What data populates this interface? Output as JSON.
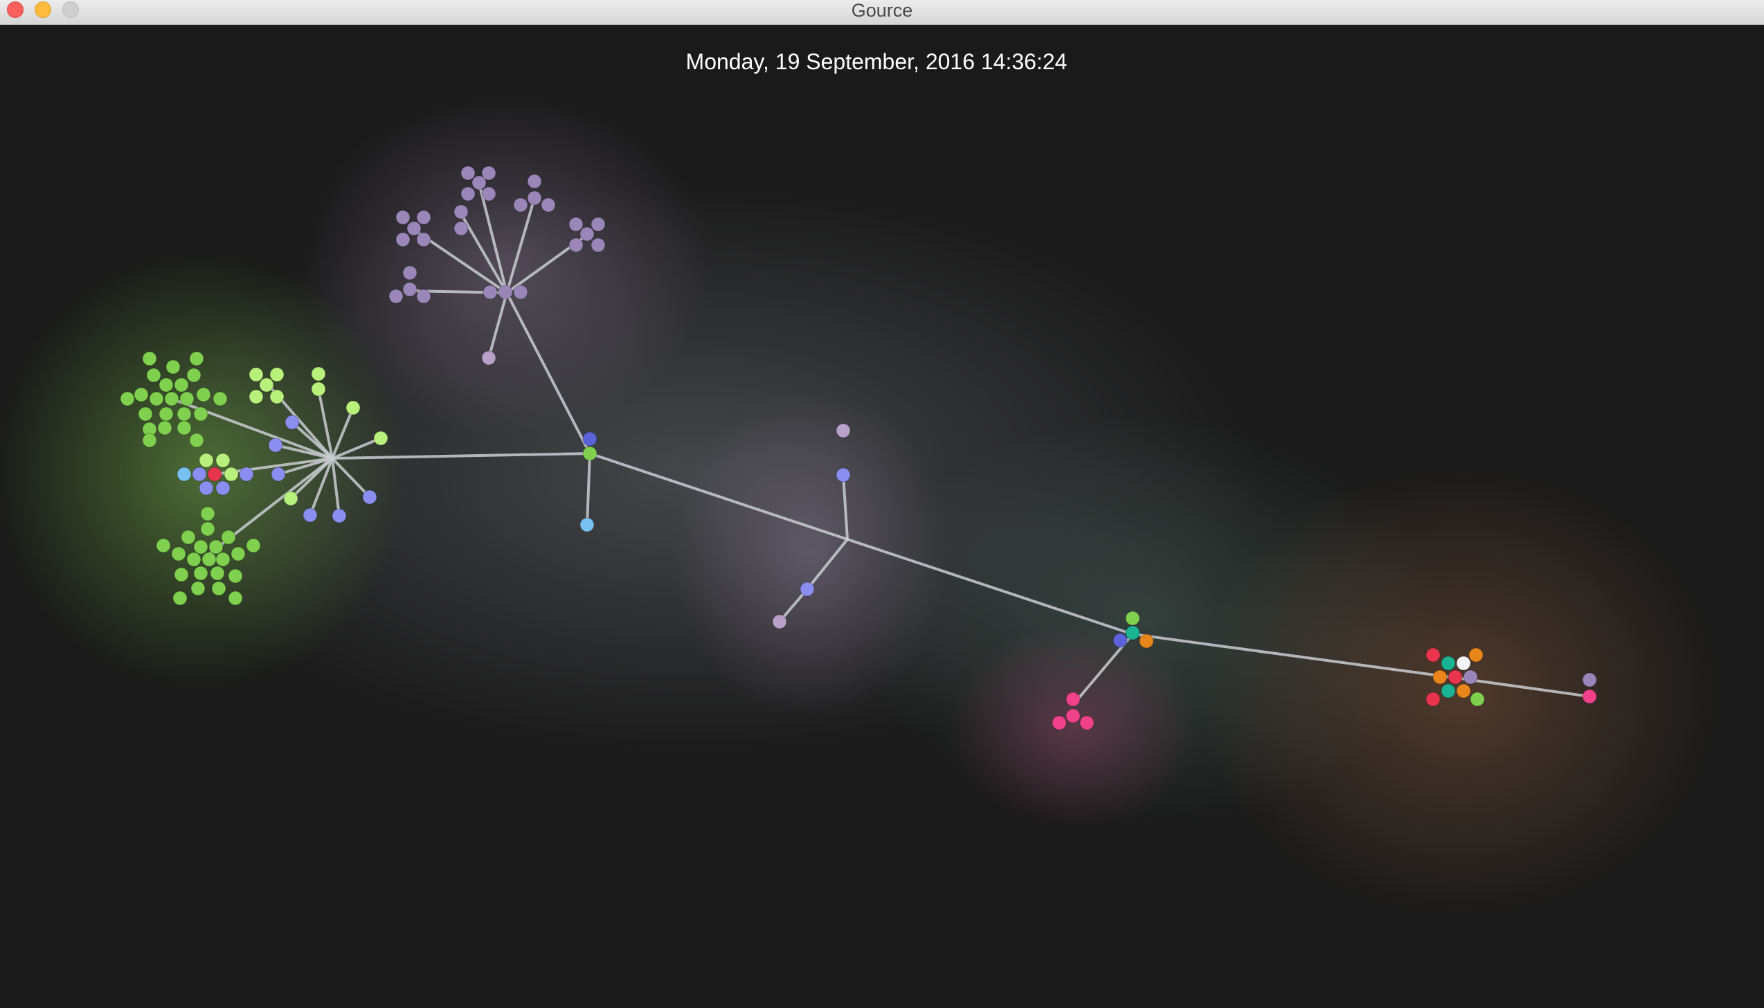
{
  "window": {
    "title": "Gource"
  },
  "visualization": {
    "date_label": "Monday, 19 September, 2016 14:36:24",
    "colors": {
      "background": "#1a1a1a",
      "edge": "#c9ccd2",
      "green": "#7fd04e",
      "light_green": "#b7f07a",
      "blue": "#8a8ef0",
      "lavender": "#b8a0c8",
      "pink": "#f0428a",
      "red": "#e8344c",
      "orange": "#e8861c",
      "teal": "#1ab394",
      "sky": "#78c0f0"
    }
  }
}
